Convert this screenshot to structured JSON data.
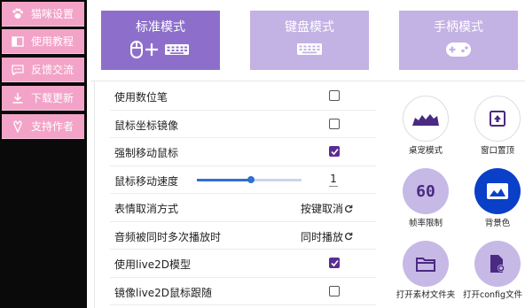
{
  "sidebar": {
    "items": [
      {
        "label": "猫咪设置",
        "icon": "paw-icon"
      },
      {
        "label": "使用教程",
        "icon": "book-icon"
      },
      {
        "label": "反馈交流",
        "icon": "chat-icon"
      },
      {
        "label": "下载更新",
        "icon": "download-icon"
      },
      {
        "label": "支持作者",
        "icon": "heart-icon"
      }
    ]
  },
  "modes": [
    {
      "label": "标准模式",
      "icon": "mouse-keyboard-icon",
      "active": true
    },
    {
      "label": "键盘模式",
      "icon": "keyboard-icon",
      "active": false
    },
    {
      "label": "手柄模式",
      "icon": "gamepad-icon",
      "active": false
    }
  ],
  "settings": {
    "rows": [
      {
        "label": "使用数位笔",
        "type": "checkbox",
        "checked": false
      },
      {
        "label": "鼠标坐标镜像",
        "type": "checkbox",
        "checked": false
      },
      {
        "label": "强制移动鼠标",
        "type": "checkbox",
        "checked": true
      },
      {
        "label": "鼠标移动速度",
        "type": "slider",
        "value": "1",
        "slider_fraction": 0.52
      },
      {
        "label": "表情取消方式",
        "type": "action",
        "value": "按键取消"
      },
      {
        "label": "音频被同时多次播放时",
        "type": "action",
        "value": "同时播放"
      },
      {
        "label": "使用live2D模型",
        "type": "checkbox",
        "checked": true
      },
      {
        "label": "镜像live2D鼠标跟随",
        "type": "checkbox",
        "checked": false
      }
    ]
  },
  "quick_actions": [
    {
      "label": "桌宠模式",
      "icon": "desk-pet-icon"
    },
    {
      "label": "窗口置顶",
      "icon": "window-top-icon"
    },
    {
      "label": "帧率限制",
      "icon": "fps-icon",
      "badge": "60"
    },
    {
      "label": "背景色",
      "icon": "background-color-icon"
    },
    {
      "label": "打开素材文件夹",
      "icon": "folder-icon"
    },
    {
      "label": "打开config文件",
      "icon": "config-file-icon"
    }
  ],
  "colors": {
    "sidebar_bg": "#0a0a0a",
    "sidebar_item": "#f2a3c7",
    "mode_active": "#8d6fcb",
    "mode_inactive": "#c3b2e4",
    "checkbox_on": "#5a2e91",
    "accent_blue": "#2f6fd0",
    "circle_light": "#c7b9e6",
    "circle_blue": "#0a3fc8"
  }
}
